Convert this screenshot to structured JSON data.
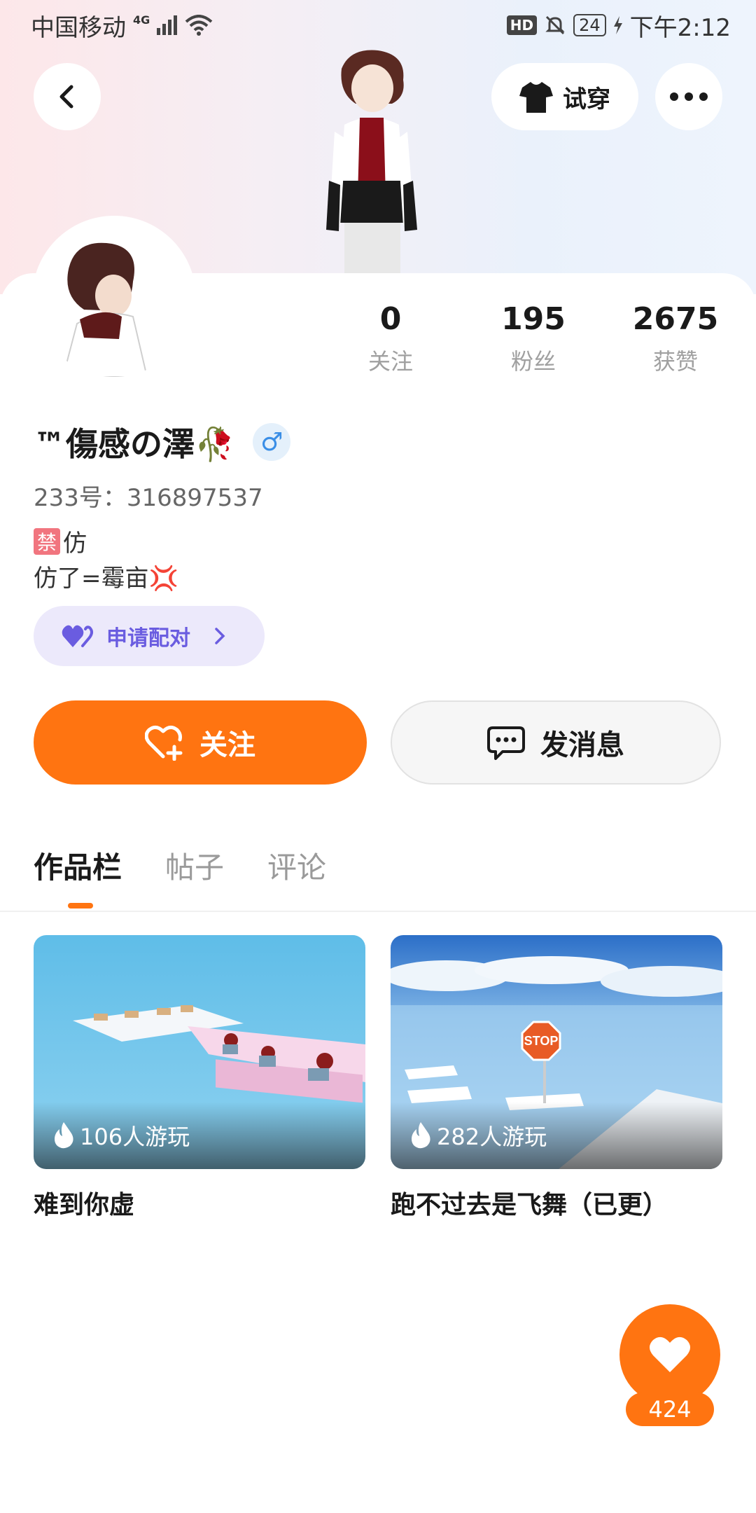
{
  "status_bar": {
    "carrier": "中国移动",
    "network": "4G",
    "hd": "HD",
    "battery": "24",
    "time": "下午2:12"
  },
  "header": {
    "try_on_label": "试穿",
    "back_icon": "chevron-left-icon",
    "more_icon": "more-dots-icon"
  },
  "stats": [
    {
      "value": "0",
      "label": "关注"
    },
    {
      "value": "195",
      "label": "粉丝"
    },
    {
      "value": "2675",
      "label": "获赞"
    }
  ],
  "profile": {
    "username": "™傷感の澤🥀",
    "gender_symbol": "♂",
    "uid": "233号：316897537",
    "bio_line1_badge": "禁",
    "bio_line1_text": "仿",
    "bio_line2": "仿了=霉亩💢"
  },
  "pair_button": {
    "label": "申请配对"
  },
  "actions": {
    "follow_label": "关注",
    "message_label": "发消息"
  },
  "tabs": [
    {
      "label": "作品栏",
      "active": true
    },
    {
      "label": "帖子",
      "active": false
    },
    {
      "label": "评论",
      "active": false
    }
  ],
  "works": [
    {
      "plays": "106人游玩",
      "title": "难到你虚"
    },
    {
      "plays": "282人游玩",
      "title": "跑不过去是飞舞（已更）"
    }
  ],
  "like_fab": {
    "count": "424"
  },
  "colors": {
    "accent": "#ff7411",
    "pair_purple": "#6a5ce0",
    "gender_blue": "#3a8ee6"
  }
}
